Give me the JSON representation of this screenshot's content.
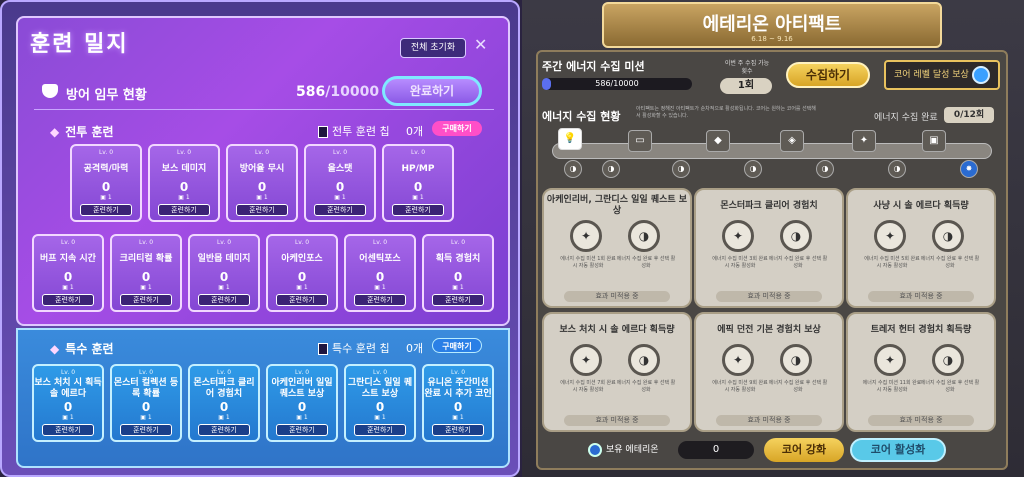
{
  "left": {
    "title": "훈련 밀지",
    "reset_label": "전체 초기화",
    "close_label": "✕",
    "mission_label": "방어 임무 현황",
    "progress_current": "586",
    "progress_total": "/10000",
    "complete_label": "완료하기",
    "combat": {
      "title": "전투 훈련",
      "chip_label": "전투 훈련 칩",
      "chip_count": "0개",
      "buy_label": "구매하기",
      "row1": [
        {
          "lv": "Lv. 0",
          "name": "공격력/마력",
          "value": "0",
          "count": "1",
          "btn": "훈련하기"
        },
        {
          "lv": "Lv. 0",
          "name": "보스 데미지",
          "value": "0",
          "count": "1",
          "btn": "훈련하기"
        },
        {
          "lv": "Lv. 0",
          "name": "방어율 무시",
          "value": "0",
          "count": "1",
          "btn": "훈련하기"
        },
        {
          "lv": "Lv. 0",
          "name": "올스탯",
          "value": "0",
          "count": "1",
          "btn": "훈련하기"
        },
        {
          "lv": "Lv. 0",
          "name": "HP/MP",
          "value": "0",
          "count": "1",
          "btn": "훈련하기"
        }
      ],
      "row2": [
        {
          "lv": "Lv. 0",
          "name": "버프 지속 시간",
          "value": "0",
          "count": "1",
          "btn": "훈련하기"
        },
        {
          "lv": "Lv. 0",
          "name": "크리티컬 확률",
          "value": "0",
          "count": "1",
          "btn": "훈련하기"
        },
        {
          "lv": "Lv. 0",
          "name": "일반몹 데미지",
          "value": "0",
          "count": "1",
          "btn": "훈련하기"
        },
        {
          "lv": "Lv. 0",
          "name": "아케인포스",
          "value": "0",
          "count": "1",
          "btn": "훈련하기"
        },
        {
          "lv": "Lv. 0",
          "name": "어센틱포스",
          "value": "0",
          "count": "1",
          "btn": "훈련하기"
        },
        {
          "lv": "Lv. 0",
          "name": "획득 경험치",
          "value": "0",
          "count": "1",
          "btn": "훈련하기"
        }
      ]
    },
    "special": {
      "title": "특수 훈련",
      "chip_label": "특수 훈련 칩",
      "chip_count": "0개",
      "buy_label": "구매하기",
      "row": [
        {
          "lv": "Lv. 0",
          "name": "보스 처치 시 획득 솔 에르다",
          "value": "0",
          "count": "1",
          "btn": "훈련하기"
        },
        {
          "lv": "Lv. 0",
          "name": "몬스터 컬렉션 등록 확률",
          "value": "0",
          "count": "1",
          "btn": "훈련하기"
        },
        {
          "lv": "Lv. 0",
          "name": "몬스터파크 클리어 경험치",
          "value": "0",
          "count": "1",
          "btn": "훈련하기"
        },
        {
          "lv": "Lv. 0",
          "name": "아케인리버 일일 퀘스트 보상",
          "value": "0",
          "count": "1",
          "btn": "훈련하기"
        },
        {
          "lv": "Lv. 0",
          "name": "그란디스 일일 퀘스트 보상",
          "value": "0",
          "count": "1",
          "btn": "훈련하기"
        },
        {
          "lv": "Lv. 0",
          "name": "유니온 주간미션 완료 시 추가 코인",
          "value": "0",
          "count": "1",
          "btn": "훈련하기"
        }
      ]
    }
  },
  "right": {
    "title": "에테리온 아티팩트",
    "dates": "6.18 ~ 9.16",
    "weekly_label": "주간 에너지 수집 미션",
    "weekly_progress": "586/10000",
    "weekly_fill": 0.0586,
    "count_label": "이번 주 수집 가능 횟수",
    "count_value": "1회",
    "collect_label": "수집하기",
    "core_reward_label": "코어 레벨 달성 보상",
    "energy_title": "에너지 수집 현황",
    "energy_desc": "아티팩트는 정해진 아티팩트가 순차적으로 활성화됩니다. 코어는 원하는 코어를 선택해서 활성화할 수 있습니다.",
    "energy_complete_label": "에너지 수집 완료",
    "energy_complete_value": "0/12회",
    "cards": [
      {
        "name": "아케인리버, 그란디스 일일 퀘스트 보상",
        "ta": "에너지 수집 미션 1회 완료 시 자동 활성화",
        "tb": "에너지 수집 완료 후 선택 활성화",
        "status": "효과 미적용 중"
      },
      {
        "name": "몬스터파크 클리어 경험치",
        "ta": "에너지 수집 미션 3회 완료 시 자동 활성화",
        "tb": "에너지 수집 완료 후 선택 활성화",
        "status": "효과 미적용 중"
      },
      {
        "name": "사냥 시 솔 에르다 획득량",
        "ta": "에너지 수집 미션 5회 완료 시 자동 활성화",
        "tb": "에너지 수집 완료 후 선택 활성화",
        "status": "효과 미적용 중"
      },
      {
        "name": "보스 처치 시 솔 에르다 획득량",
        "ta": "에너지 수집 미션 7회 완료 시 자동 활성화",
        "tb": "에너지 수집 완료 후 선택 활성화",
        "status": "효과 미적용 중"
      },
      {
        "name": "에픽 던전 기본 경험치 보상",
        "ta": "에너지 수집 미션 9회 완료 시 자동 활성화",
        "tb": "에너지 수집 완료 후 선택 활성화",
        "status": "효과 미적용 중"
      },
      {
        "name": "트레저 헌터 경험치 획득량",
        "ta": "에너지 수집 미션 11회 완료 시 자동 활성화",
        "tb": "에너지 수집 완료 후 선택 활성화",
        "status": "효과 미적용 중"
      }
    ],
    "hold_label": "보유 에테리온",
    "hold_value": "0",
    "enhance_label": "코어 강화",
    "activate_label": "코어 활성화"
  }
}
